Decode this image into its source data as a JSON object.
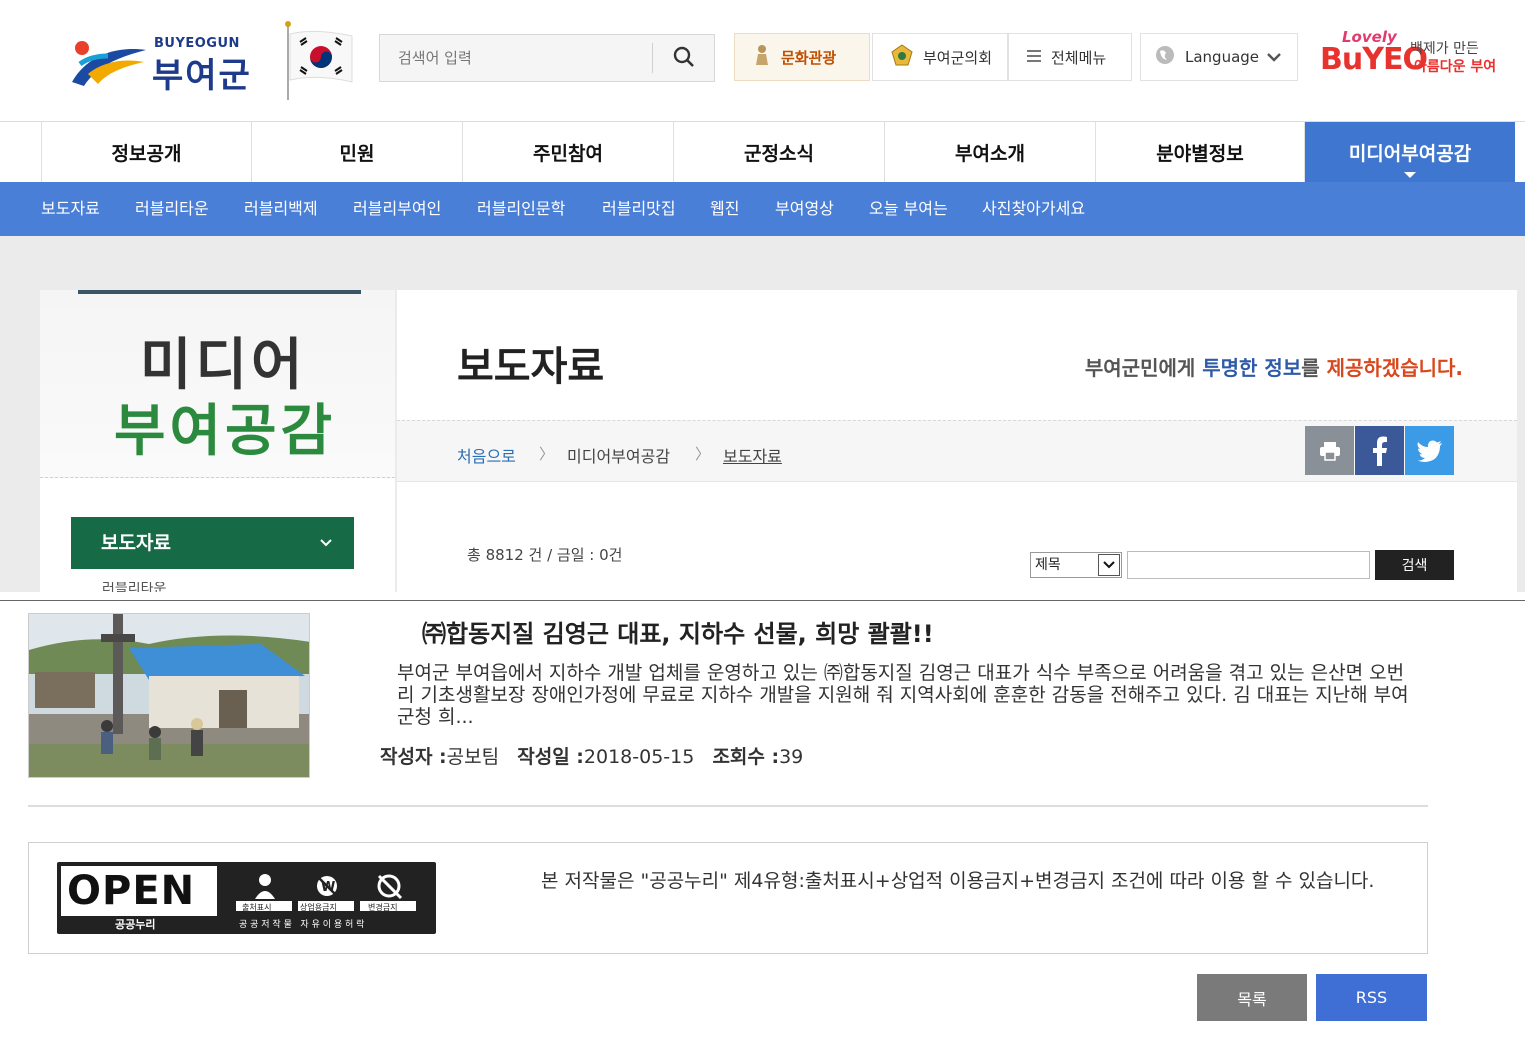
{
  "header": {
    "logo_en": "BUYEOGUN",
    "logo_ko": "부여군",
    "search_placeholder": "검색어 입력",
    "links": {
      "culture": "문화관광",
      "council": "부여군의회",
      "all_menu": "전체메뉴"
    },
    "language": "Language",
    "slogan_logo": {
      "lovely": "Lovely",
      "buyeo": "BuYEO",
      "line1": "백제가 만든",
      "line2": "아름다운 부여"
    }
  },
  "gnb": [
    "정보공개",
    "민원",
    "주민참여",
    "군정소식",
    "부여소개",
    "분야별정보",
    "미디어부여공감"
  ],
  "subnav": [
    "보도자료",
    "러블리타운",
    "러블리백제",
    "러블리부여인",
    "러블리인문학",
    "러블리맛집",
    "웹진",
    "부여영상",
    "오늘 부여는",
    "사진찾아가세요"
  ],
  "side": {
    "title_line1": "미디어",
    "title_line2": "부여공감",
    "active_item": "보도자료",
    "next_item": "러블리타운"
  },
  "main": {
    "page_title": "보도자료",
    "slogan": {
      "part1": "부여군민에게 ",
      "part2": "투명한 정보",
      "part3": "를 ",
      "part4": "제공하겠습니다."
    },
    "breadcrumb": [
      "처음으로",
      "미디어부여공감",
      "보도자료"
    ],
    "total_text": "총 8812 건 / 금일 : 0건",
    "search_select": "제목",
    "search_button": "검색"
  },
  "article": {
    "title": "㈜합동지질 김영근 대표, 지하수 선물, 희망 콸콸!!",
    "body": "부여군 부여읍에서 지하수 개발 업체를 운영하고 있는 ㈜합동지질 김영근 대표가 식수 부족으로 어려움을 겪고 있는 은산면 오번리 기초생활보장 장애인가정에 무료로 지하수 개발을 지원해 줘 지역사회에 훈훈한 감동을 전해주고 있다. 김 대표는 지난해 부여군청 희...",
    "author_label": "작성자 :",
    "author": "공보팀",
    "date_label": "작성일 :",
    "date": "2018-05-15",
    "views_label": "조회수 :",
    "views": "39"
  },
  "license": {
    "open_text": "OPEN",
    "nuri": "공공누리",
    "badges": [
      "출처표시",
      "상업용금지",
      "변경금지"
    ],
    "caption": "공 공 저 작 물   자 유 이 용 허 락",
    "text": "본 저작물은 \"공공누리\" 제4유형:출처표시+상업적 이용금지+변경금지 조건에 따라 이용 할 수 있습니다."
  },
  "buttons": {
    "list": "목록",
    "rss": "RSS"
  },
  "colors": {
    "primary_blue": "#4a7fd8",
    "active_green": "#166b46",
    "accent_orange": "#d8481e"
  }
}
